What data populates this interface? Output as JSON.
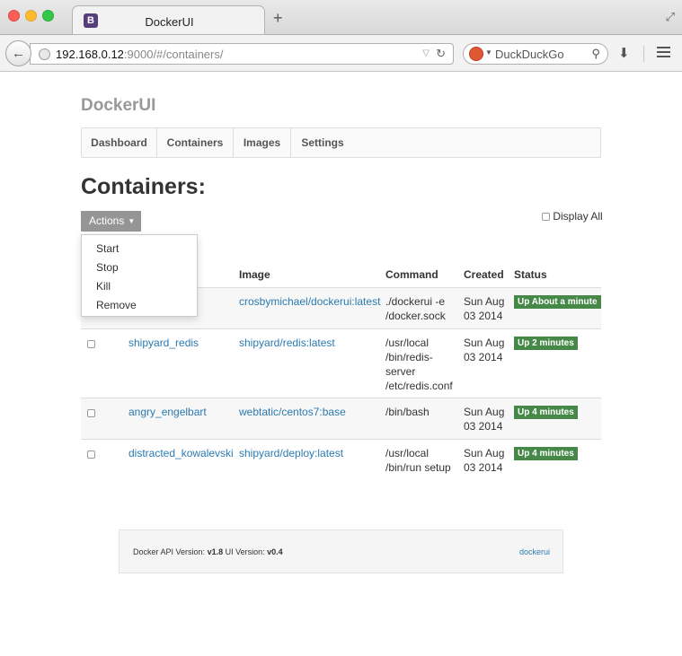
{
  "browser": {
    "tab_title": "DockerUI",
    "tab_favicon_letter": "B",
    "url_host": "192.168.0.12",
    "url_rest": ":9000/#/containers/",
    "search_placeholder": "DuckDuckGo"
  },
  "app": {
    "brand": "DockerUI",
    "nav": [
      "Dashboard",
      "Containers",
      "Images",
      "Settings"
    ],
    "page_title": "Containers:",
    "actions_label": "Actions",
    "display_all_label": "Display All",
    "actions_menu": [
      "Start",
      "Stop",
      "Kill",
      "Remove"
    ]
  },
  "table": {
    "headers": {
      "image": "Image",
      "command": "Command",
      "created": "Created",
      "status": "Status"
    },
    "rows": [
      {
        "name": "",
        "image": "crosbymichael/dockerui:latest",
        "command": "./dockerui -e /docker.sock",
        "created": "Sun Aug 03 2014",
        "status": "Up About a minute"
      },
      {
        "name": "shipyard_redis",
        "image": "shipyard/redis:latest",
        "command": "/usr/local /bin/redis- server /etc/redis.conf",
        "created": "Sun Aug 03 2014",
        "status": "Up 2 minutes"
      },
      {
        "name": "angry_engelbart",
        "image": "webtatic/centos7:base",
        "command": "/bin/bash",
        "created": "Sun Aug 03 2014",
        "status": "Up 4 minutes"
      },
      {
        "name": "distracted_kowalevski",
        "image": "shipyard/deploy:latest",
        "command": "/usr/local /bin/run setup",
        "created": "Sun Aug 03 2014",
        "status": "Up 4 minutes"
      }
    ],
    "cell_lines": [
      {
        "image": [
          "crosbymichael/dockerui:latest"
        ],
        "command": [
          "./dockerui -e",
          "/docker.sock"
        ],
        "created": [
          "Sun Aug",
          "03 2014"
        ]
      },
      {
        "image": [
          "shipyard/redis:latest"
        ],
        "command": [
          "/usr/local",
          "/bin/redis-",
          "server",
          "/etc/redis.conf"
        ],
        "created": [
          "Sun Aug",
          "03 2014"
        ]
      },
      {
        "image": [
          "webtatic/centos7:base"
        ],
        "command": [
          "/bin/bash"
        ],
        "created": [
          "Sun Aug",
          "03 2014"
        ]
      },
      {
        "image": [
          "shipyard/deploy:latest"
        ],
        "command": [
          "/usr/local",
          "/bin/run setup"
        ],
        "created": [
          "Sun Aug",
          "03 2014"
        ]
      }
    ]
  },
  "footer": {
    "api_label": "Docker API Version:",
    "api_version": "v1.8",
    "ui_label": "UI Version:",
    "ui_version": "v0.4",
    "link": "dockerui"
  },
  "colors": {
    "status_badge": "#468847",
    "link": "#2a7ab0",
    "actions_button": "#959595"
  }
}
